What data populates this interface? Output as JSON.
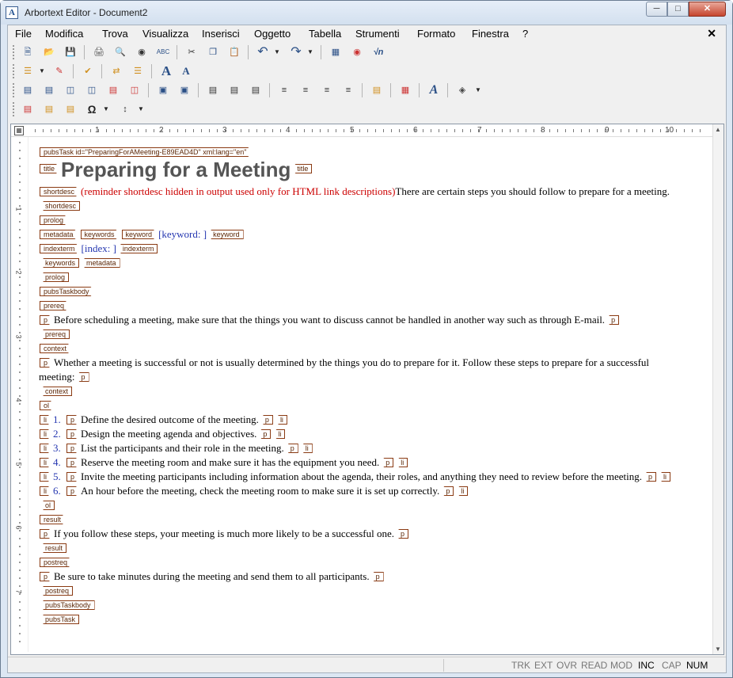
{
  "window": {
    "title": "Arbortext Editor - Document2",
    "app_icon": "A"
  },
  "menubar": [
    "File",
    "Modifica",
    "Trova",
    "Visualizza",
    "Inserisci",
    "Oggetto",
    "Tabella",
    "Strumenti",
    "Formato",
    "Finestra",
    "?"
  ],
  "toolbar_icons": {
    "row1": [
      "new-document-icon",
      "open-folder-icon",
      "save-icon",
      "print-icon",
      "print-preview-icon",
      "find-binoculars-icon",
      "spellcheck-icon",
      "cut-icon",
      "copy-icon",
      "paste-icon",
      "undo-icon",
      "redo-icon",
      "table-icon",
      "insert-image-icon",
      "insert-equation-icon"
    ],
    "row2": [
      "insert-markup-icon",
      "edit-markup-icon",
      "validate-icon",
      "change-markup-icon",
      "modify-attributes-icon",
      "increase-font-icon",
      "decrease-font-icon"
    ],
    "row3": [
      "table-row-above-icon",
      "table-row-below-icon",
      "table-col-left-icon",
      "table-col-right-icon",
      "table-split-icon",
      "table-delete-icon",
      "merge-cells-icon",
      "split-cells-icon",
      "align-top-icon",
      "align-middle-icon",
      "align-bottom-icon",
      "align-left-icon",
      "align-center-icon",
      "align-right-icon",
      "justify-icon",
      "cell-properties-icon",
      "table-properties-icon",
      "text-style-icon",
      "fill-color-icon"
    ],
    "row4": [
      "insert-entity-icon",
      "insert-entity-ref-icon",
      "insert-comment-icon",
      "special-characters-icon",
      "line-spacing-icon"
    ]
  },
  "ruler": [
    "1",
    "2",
    "3",
    "4",
    "5",
    "6",
    "7",
    "8",
    "9",
    "10"
  ],
  "vruler": [
    "1",
    "2",
    "3",
    "4",
    "5",
    "6",
    "7"
  ],
  "document": {
    "root_tag": "pubsTask id=\"PreparingForAMeeting-E89EAD4D\" xml:lang=\"en\"",
    "title": "Preparing for a Meeting",
    "shortdesc_note": "(reminder shortdesc hidden in output used only for HTML link descriptions)",
    "shortdesc_text": "There are certain steps you should follow to prepare for a meeting.",
    "keyword_placeholder": "[keyword: ]",
    "index_placeholder": "[index: ]",
    "prereq_text": "Before scheduling a meeting, make sure that the things you want to discuss cannot be handled in another way such as through E-mail.",
    "context_text_1": "Whether a meeting is successful or not is usually determined by the things you do to prepare for it. Follow these steps to prepare for a successful",
    "context_text_2": "meeting:",
    "steps": [
      {
        "num": "1.",
        "text": "Define the desired outcome of the meeting."
      },
      {
        "num": "2.",
        "text": "Design the meeting agenda and objectives."
      },
      {
        "num": "3.",
        "text": "List the participants and their role in the meeting."
      },
      {
        "num": "4.",
        "text": "Reserve the meeting room and make sure it has the equipment you need."
      },
      {
        "num": "5.",
        "text": "Invite the meeting participants including information about the agenda, their roles, and anything they need to review before the meeting."
      },
      {
        "num": "6.",
        "text": "An hour before the meeting, check the meeting room to make sure it is set up correctly."
      }
    ],
    "result_text": "If you follow these steps, your meeting is much more likely to be a successful one.",
    "postreq_text": "Be sure to take minutes during the meeting and send them to all participants."
  },
  "tags": {
    "title": "title",
    "shortdesc": "shortdesc",
    "prolog": "prolog",
    "metadata": "metadata",
    "keywords": "keywords",
    "keyword": "keyword",
    "indexterm": "indexterm",
    "pubsTaskbody": "pubsTaskbody",
    "prereq": "prereq",
    "p": "p",
    "context": "context",
    "ol": "ol",
    "li": "li",
    "result": "result",
    "postreq": "postreq",
    "pubsTask": "pubsTask"
  },
  "statusbar": [
    {
      "label": "TRK",
      "active": false
    },
    {
      "label": "EXT",
      "active": false
    },
    {
      "label": "OVR",
      "active": false
    },
    {
      "label": "READ",
      "active": false
    },
    {
      "label": "MOD",
      "active": false
    },
    {
      "label": "INC",
      "active": true
    },
    {
      "label": "CAP",
      "active": false
    },
    {
      "label": "NUM",
      "active": true
    }
  ]
}
